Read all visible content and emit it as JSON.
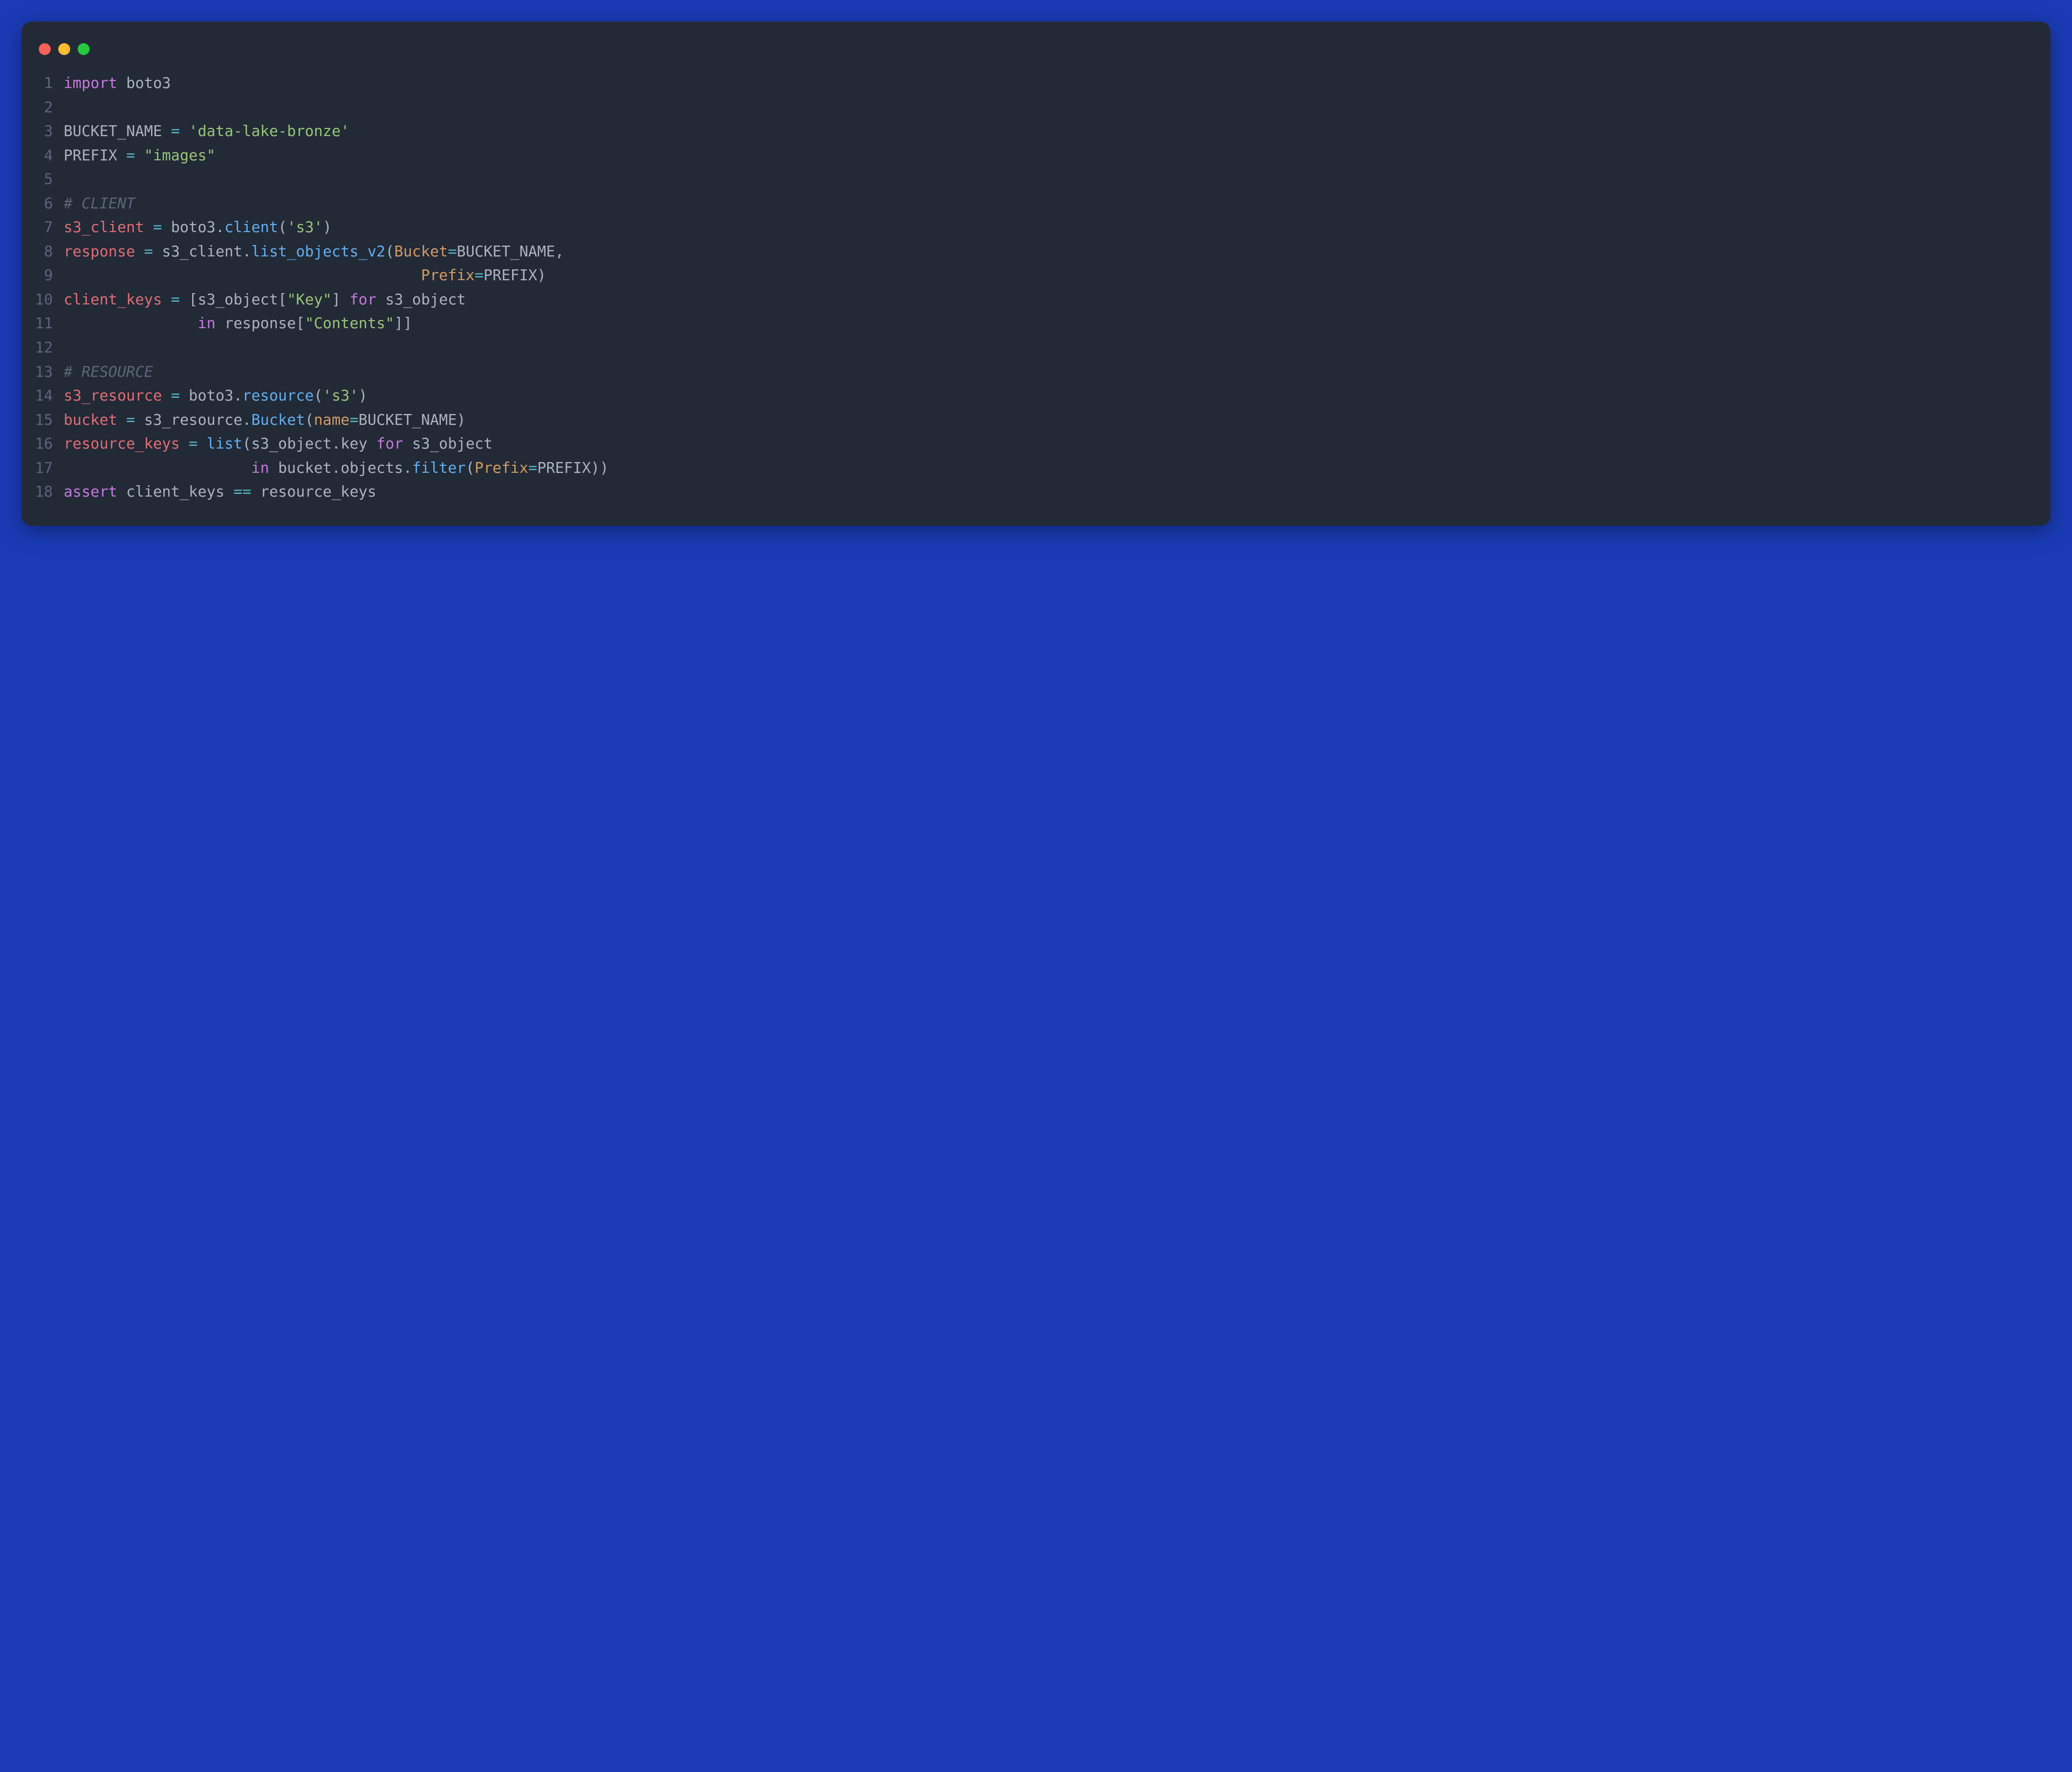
{
  "window": {
    "traffic_lights": [
      "red",
      "yellow",
      "green"
    ]
  },
  "code": {
    "lines": [
      {
        "n": "1",
        "tokens": [
          [
            "kw",
            "import"
          ],
          [
            "plain",
            " "
          ],
          [
            "plain",
            "boto3"
          ]
        ]
      },
      {
        "n": "2",
        "tokens": []
      },
      {
        "n": "3",
        "tokens": [
          [
            "plain",
            "BUCKET_NAME "
          ],
          [
            "op",
            "="
          ],
          [
            "plain",
            " "
          ],
          [
            "str",
            "'data-lake-bronze'"
          ]
        ]
      },
      {
        "n": "4",
        "tokens": [
          [
            "plain",
            "PREFIX "
          ],
          [
            "op",
            "="
          ],
          [
            "plain",
            " "
          ],
          [
            "str",
            "\"images\""
          ]
        ]
      },
      {
        "n": "5",
        "tokens": []
      },
      {
        "n": "6",
        "tokens": [
          [
            "com",
            "# CLIENT"
          ]
        ]
      },
      {
        "n": "7",
        "tokens": [
          [
            "tealvar",
            "s3_client"
          ],
          [
            "plain",
            " "
          ],
          [
            "op",
            "="
          ],
          [
            "plain",
            " boto3"
          ],
          [
            "pun",
            "."
          ],
          [
            "fn",
            "client"
          ],
          [
            "pun",
            "("
          ],
          [
            "str",
            "'s3'"
          ],
          [
            "pun",
            ")"
          ]
        ]
      },
      {
        "n": "8",
        "tokens": [
          [
            "tealvar",
            "response"
          ],
          [
            "plain",
            " "
          ],
          [
            "op",
            "="
          ],
          [
            "plain",
            " s3_client"
          ],
          [
            "pun",
            "."
          ],
          [
            "fn",
            "list_objects_v2"
          ],
          [
            "pun",
            "("
          ],
          [
            "arg",
            "Bucket"
          ],
          [
            "op",
            "="
          ],
          [
            "plain",
            "BUCKET_NAME"
          ],
          [
            "pun",
            ","
          ]
        ]
      },
      {
        "n": "9",
        "tokens": [
          [
            "plain",
            "                                        "
          ],
          [
            "arg",
            "Prefix"
          ],
          [
            "op",
            "="
          ],
          [
            "plain",
            "PREFIX"
          ],
          [
            "pun",
            ")"
          ]
        ]
      },
      {
        "n": "10",
        "tokens": [
          [
            "tealvar",
            "client_keys"
          ],
          [
            "plain",
            " "
          ],
          [
            "op",
            "="
          ],
          [
            "plain",
            " "
          ],
          [
            "pun",
            "["
          ],
          [
            "plain",
            "s3_object"
          ],
          [
            "pun",
            "["
          ],
          [
            "str",
            "\"Key\""
          ],
          [
            "pun",
            "]"
          ],
          [
            "plain",
            " "
          ],
          [
            "kw",
            "for"
          ],
          [
            "plain",
            " s3_object"
          ]
        ]
      },
      {
        "n": "11",
        "tokens": [
          [
            "plain",
            "               "
          ],
          [
            "kw",
            "in"
          ],
          [
            "plain",
            " response"
          ],
          [
            "pun",
            "["
          ],
          [
            "str",
            "\"Contents\""
          ],
          [
            "pun",
            "]]"
          ]
        ]
      },
      {
        "n": "12",
        "tokens": []
      },
      {
        "n": "13",
        "tokens": [
          [
            "com",
            "# RESOURCE"
          ]
        ]
      },
      {
        "n": "14",
        "tokens": [
          [
            "tealvar",
            "s3_resource"
          ],
          [
            "plain",
            " "
          ],
          [
            "op",
            "="
          ],
          [
            "plain",
            " boto3"
          ],
          [
            "pun",
            "."
          ],
          [
            "fn",
            "resource"
          ],
          [
            "pun",
            "("
          ],
          [
            "str",
            "'s3'"
          ],
          [
            "pun",
            ")"
          ]
        ]
      },
      {
        "n": "15",
        "tokens": [
          [
            "tealvar",
            "bucket"
          ],
          [
            "plain",
            " "
          ],
          [
            "op",
            "="
          ],
          [
            "plain",
            " s3_resource"
          ],
          [
            "pun",
            "."
          ],
          [
            "fn",
            "Bucket"
          ],
          [
            "pun",
            "("
          ],
          [
            "arg",
            "name"
          ],
          [
            "op",
            "="
          ],
          [
            "plain",
            "BUCKET_NAME"
          ],
          [
            "pun",
            ")"
          ]
        ]
      },
      {
        "n": "16",
        "tokens": [
          [
            "tealvar",
            "resource_keys"
          ],
          [
            "plain",
            " "
          ],
          [
            "op",
            "="
          ],
          [
            "plain",
            " "
          ],
          [
            "fn",
            "list"
          ],
          [
            "pun",
            "("
          ],
          [
            "plain",
            "s3_object"
          ],
          [
            "pun",
            "."
          ],
          [
            "plain",
            "key "
          ],
          [
            "kw",
            "for"
          ],
          [
            "plain",
            " s3_object"
          ]
        ]
      },
      {
        "n": "17",
        "tokens": [
          [
            "plain",
            "                     "
          ],
          [
            "kw",
            "in"
          ],
          [
            "plain",
            " bucket"
          ],
          [
            "pun",
            "."
          ],
          [
            "plain",
            "objects"
          ],
          [
            "pun",
            "."
          ],
          [
            "fn",
            "filter"
          ],
          [
            "pun",
            "("
          ],
          [
            "arg",
            "Prefix"
          ],
          [
            "op",
            "="
          ],
          [
            "plain",
            "PREFIX"
          ],
          [
            "pun",
            "))"
          ]
        ]
      },
      {
        "n": "18",
        "tokens": [
          [
            "kw",
            "assert"
          ],
          [
            "plain",
            " client_keys "
          ],
          [
            "op",
            "=="
          ],
          [
            "plain",
            " resource_keys"
          ]
        ]
      }
    ]
  }
}
